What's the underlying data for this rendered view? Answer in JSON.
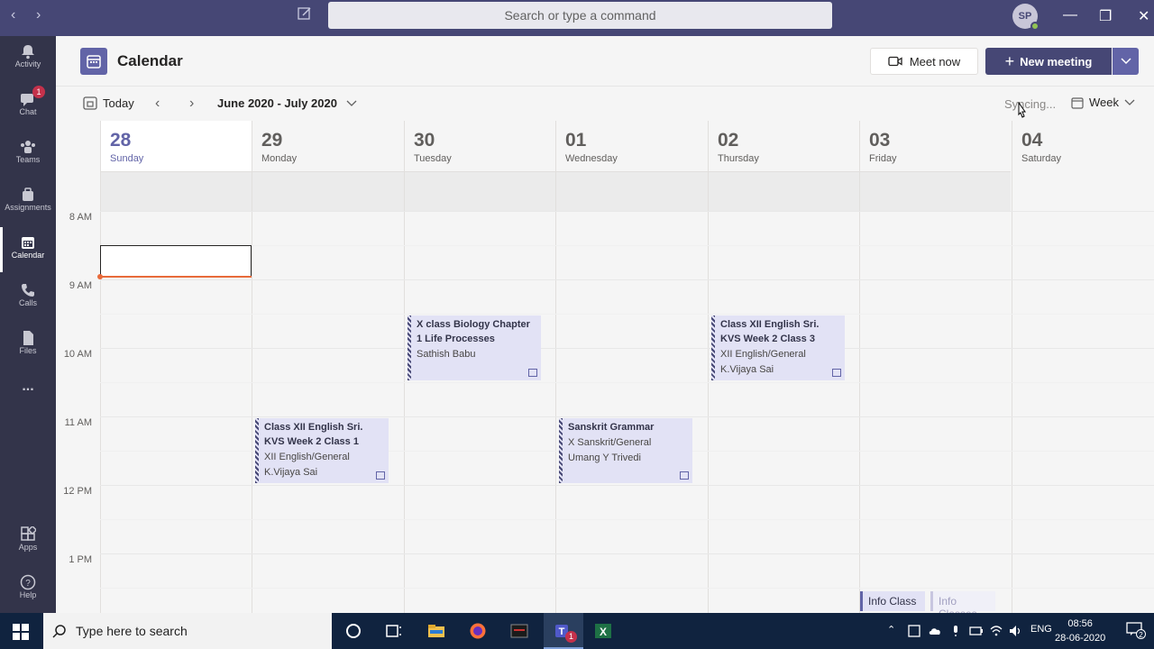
{
  "titlebar": {
    "search_placeholder": "Search or type a command",
    "avatar_initials": "SP"
  },
  "rail": {
    "items": [
      {
        "label": "Activity",
        "icon": "bell-icon"
      },
      {
        "label": "Chat",
        "icon": "chat-icon",
        "badge": "1"
      },
      {
        "label": "Teams",
        "icon": "teams-icon"
      },
      {
        "label": "Assignments",
        "icon": "assignments-icon"
      },
      {
        "label": "Calendar",
        "icon": "calendar-icon",
        "active": true
      },
      {
        "label": "Calls",
        "icon": "phone-icon"
      },
      {
        "label": "Files",
        "icon": "file-icon"
      },
      {
        "label": "Apps",
        "icon": "apps-icon"
      },
      {
        "label": "Help",
        "icon": "help-icon"
      }
    ],
    "more": "..."
  },
  "header": {
    "title": "Calendar",
    "meet_now": "Meet now",
    "new_meeting": "New meeting"
  },
  "toolbar": {
    "today": "Today",
    "range": "June 2020 - July 2020",
    "syncing": "Syncing...",
    "view": "Week"
  },
  "days": [
    {
      "num": "28",
      "name": "Sunday"
    },
    {
      "num": "29",
      "name": "Monday"
    },
    {
      "num": "30",
      "name": "Tuesday"
    },
    {
      "num": "01",
      "name": "Wednesday"
    },
    {
      "num": "02",
      "name": "Thursday"
    },
    {
      "num": "03",
      "name": "Friday"
    },
    {
      "num": "04",
      "name": "Saturday"
    }
  ],
  "times": [
    "8 AM",
    "9 AM",
    "10 AM",
    "11 AM",
    "12 PM",
    "1 PM"
  ],
  "events": [
    {
      "title": "X class Biology Chapter 1 Life Processes",
      "sub1": "Sathish Babu",
      "sub2": ""
    },
    {
      "title": "Class XII English Sri. KVS Week 2 Class 3",
      "sub1": "XII English/General",
      "sub2": "K.Vijaya Sai"
    },
    {
      "title": "Class XII English Sri. KVS Week 2 Class 1",
      "sub1": "XII English/General",
      "sub2": "K.Vijaya Sai"
    },
    {
      "title": "Sanskrit Grammar",
      "sub1": "X Sanskrit/General",
      "sub2": "Umang Y Trivedi"
    }
  ],
  "info_chips": [
    "Info Class",
    "Info Classes"
  ],
  "taskbar": {
    "search_placeholder": "Type here to search",
    "lang": "ENG",
    "time": "08:56",
    "date": "28-06-2020",
    "notif_count": "2",
    "teams_badge": "1"
  },
  "colors": {
    "accent": "#6264a7",
    "titlebar": "#464775",
    "rail": "#33344a",
    "event_bg": "#e2e2f5"
  }
}
